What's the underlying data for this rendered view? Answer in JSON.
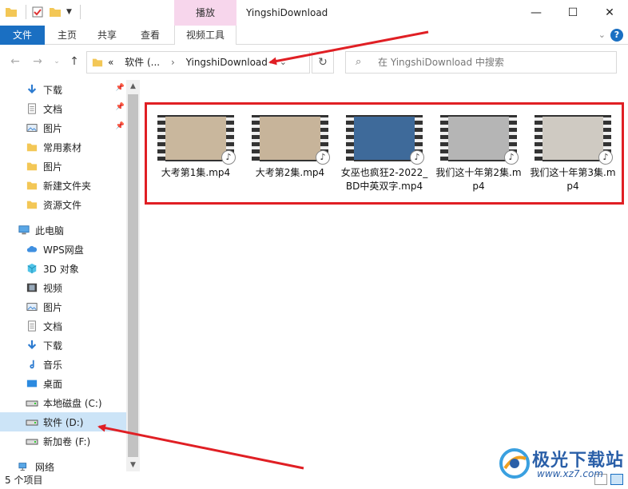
{
  "title_bar": {
    "context_tab": "播放",
    "window_title": "YingshiDownload",
    "minimize_icon": "minimize-icon",
    "maximize_icon": "maximize-icon",
    "close_icon": "close-icon"
  },
  "ribbon": {
    "tabs": [
      "文件",
      "主页",
      "共享",
      "查看",
      "视频工具"
    ],
    "help": "?"
  },
  "address": {
    "crumbs": [
      "软件 (...",
      "YingshiDownload"
    ],
    "prefix": "«"
  },
  "search": {
    "placeholder": "在 YingshiDownload 中搜索"
  },
  "sidebar": {
    "items": [
      {
        "label": "下载",
        "icon": "download-icon",
        "pinned": true
      },
      {
        "label": "文档",
        "icon": "document-icon",
        "pinned": true
      },
      {
        "label": "图片",
        "icon": "picture-icon",
        "pinned": true
      },
      {
        "label": "常用素材",
        "icon": "folder-icon"
      },
      {
        "label": "图片",
        "icon": "folder-icon"
      },
      {
        "label": "新建文件夹",
        "icon": "folder-icon"
      },
      {
        "label": "资源文件",
        "icon": "folder-icon"
      },
      {
        "label": "此电脑",
        "icon": "computer-icon"
      },
      {
        "label": "WPS网盘",
        "icon": "cloud-icon"
      },
      {
        "label": "3D 对象",
        "icon": "cube-icon"
      },
      {
        "label": "视频",
        "icon": "video-icon"
      },
      {
        "label": "图片",
        "icon": "picture-icon"
      },
      {
        "label": "文档",
        "icon": "document-icon"
      },
      {
        "label": "下载",
        "icon": "download-icon"
      },
      {
        "label": "音乐",
        "icon": "music-icon"
      },
      {
        "label": "桌面",
        "icon": "desktop-icon"
      },
      {
        "label": "本地磁盘 (C:)",
        "icon": "drive-icon"
      },
      {
        "label": "软件 (D:)",
        "icon": "drive-icon",
        "selected": true
      },
      {
        "label": "新加卷 (F:)",
        "icon": "drive-icon"
      },
      {
        "label": "网络",
        "icon": "network-icon"
      }
    ]
  },
  "files": [
    {
      "name": "大考第1集.mp4",
      "thumb": "#c9b79d"
    },
    {
      "name": "大考第2集.mp4",
      "thumb": "#c7b49a"
    },
    {
      "name": "女巫也疯狂2-2022_BD中英双字.mp4",
      "thumb": "#3e6a9a"
    },
    {
      "name": "我们这十年第2集.mp4",
      "thumb": "#b5b5b5"
    },
    {
      "name": "我们这十年第3集.mp4",
      "thumb": "#cfcac2"
    }
  ],
  "status": {
    "count": "5 个项目"
  },
  "watermark": {
    "title": "极光下载站",
    "url": "www.xz7.com"
  },
  "colors": {
    "accent": "#1a6fc2",
    "context_tab": "#f7d6ec",
    "annotation_red": "#e01f24"
  }
}
